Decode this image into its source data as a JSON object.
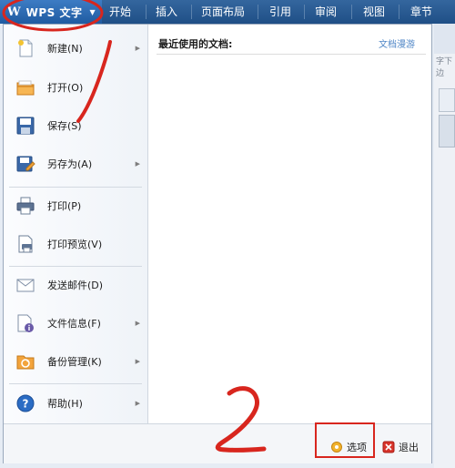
{
  "app": {
    "logo": "W",
    "name": "WPS 文字"
  },
  "tabs": [
    "开始",
    "插入",
    "页面布局",
    "引用",
    "审阅",
    "视图",
    "章节"
  ],
  "menu": {
    "items": [
      {
        "label": "新建(N)",
        "icon": "new-document-icon",
        "submenu": true
      },
      {
        "label": "打开(O)",
        "icon": "open-folder-icon",
        "submenu": false
      },
      {
        "label": "保存(S)",
        "icon": "save-icon",
        "submenu": false
      },
      {
        "label": "另存为(A)",
        "icon": "save-as-icon",
        "submenu": true
      },
      {
        "label": "打印(P)",
        "icon": "print-icon",
        "submenu": false
      },
      {
        "label": "打印预览(V)",
        "icon": "print-preview-icon",
        "submenu": false
      },
      {
        "label": "发送邮件(D)",
        "icon": "email-icon",
        "submenu": false
      },
      {
        "label": "文件信息(F)",
        "icon": "file-info-icon",
        "submenu": true
      },
      {
        "label": "备份管理(K)",
        "icon": "backup-icon",
        "submenu": true
      },
      {
        "label": "帮助(H)",
        "icon": "help-icon",
        "submenu": true
      }
    ]
  },
  "recent": {
    "title": "最近使用的文档:",
    "roaming_link": "文档漫游"
  },
  "footer": {
    "options_label": "选项",
    "exit_label": "退出"
  },
  "background": {
    "right_text": "字下边"
  },
  "colors": {
    "menubar": "#1f4f86",
    "annotation": "#d8261e",
    "link": "#4f86c6"
  }
}
